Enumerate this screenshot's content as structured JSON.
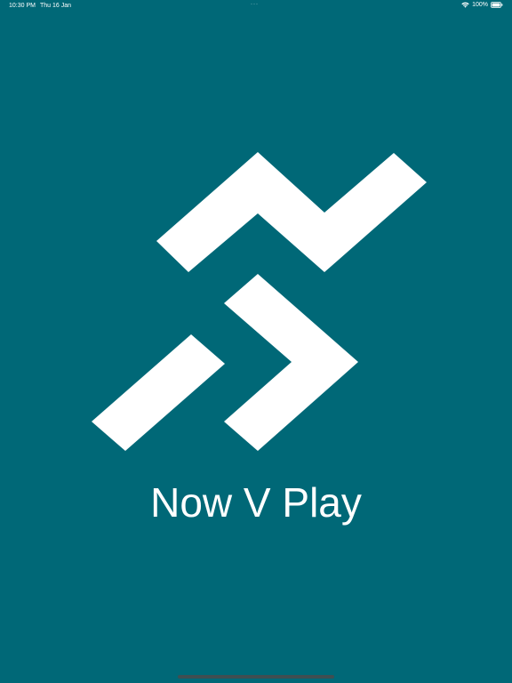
{
  "status_bar": {
    "time": "10:30 PM",
    "date": "Thu 16 Jan",
    "dots": "···",
    "battery": "100%",
    "icons": [
      "wifi-icon",
      "battery-icon"
    ]
  },
  "splash": {
    "logo": "now-v-play-logo",
    "app_name": "Now V Play"
  },
  "colors": {
    "background": "#006877",
    "foreground": "#ffffff"
  }
}
